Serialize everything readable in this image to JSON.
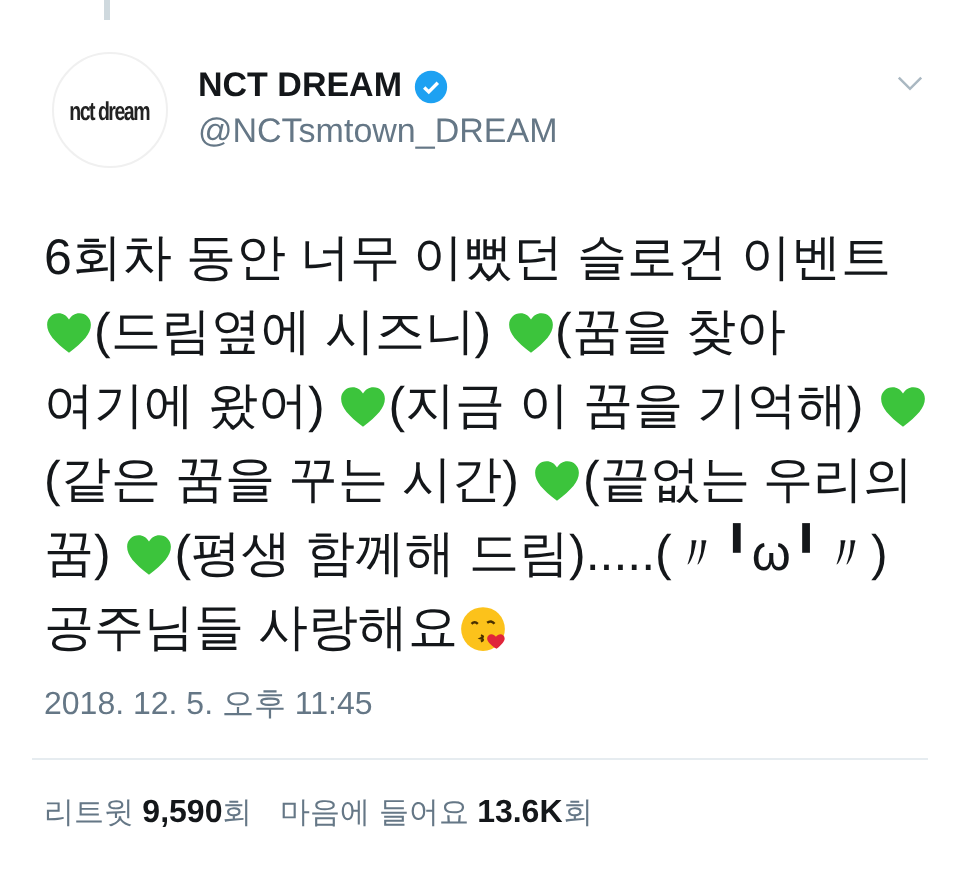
{
  "author": {
    "logo_text": "nct dream",
    "name": "NCT DREAM",
    "verified": true,
    "handle": "@NCTsmtown_DREAM"
  },
  "tweet": {
    "lines": [
      [
        {
          "kind": "text",
          "text": "6회차 동안 너무 이뻤던 슬로건 이벤트"
        }
      ],
      [
        {
          "kind": "heart"
        },
        {
          "kind": "text",
          "text": "(드림옆에 시즈니) "
        },
        {
          "kind": "heart"
        },
        {
          "kind": "text",
          "text": "(꿈을 찾아"
        }
      ],
      [
        {
          "kind": "text",
          "text": "여기에 왔어) "
        },
        {
          "kind": "heart"
        },
        {
          "kind": "text",
          "text": "(지금 이 꿈을 기억해) "
        },
        {
          "kind": "heart"
        }
      ],
      [
        {
          "kind": "text",
          "text": "(같은 꿈을 꾸는 시간) "
        },
        {
          "kind": "heart"
        },
        {
          "kind": "text",
          "text": "(끝없는 우리의"
        }
      ],
      [
        {
          "kind": "text",
          "text": "꿈) "
        },
        {
          "kind": "heart"
        },
        {
          "kind": "text",
          "text": "(평생 함께해 드림).....(〃╹ω╹〃)"
        }
      ],
      [
        {
          "kind": "text",
          "text": "공주님들 사랑해요"
        },
        {
          "kind": "kiss"
        }
      ]
    ]
  },
  "timestamp": "2018. 12. 5. 오후 11:45",
  "stats": [
    {
      "label": "리트윗",
      "count": "9,590",
      "unit": "회"
    },
    {
      "label": "마음에 들어요",
      "count": "13.6K",
      "unit": "회"
    }
  ]
}
